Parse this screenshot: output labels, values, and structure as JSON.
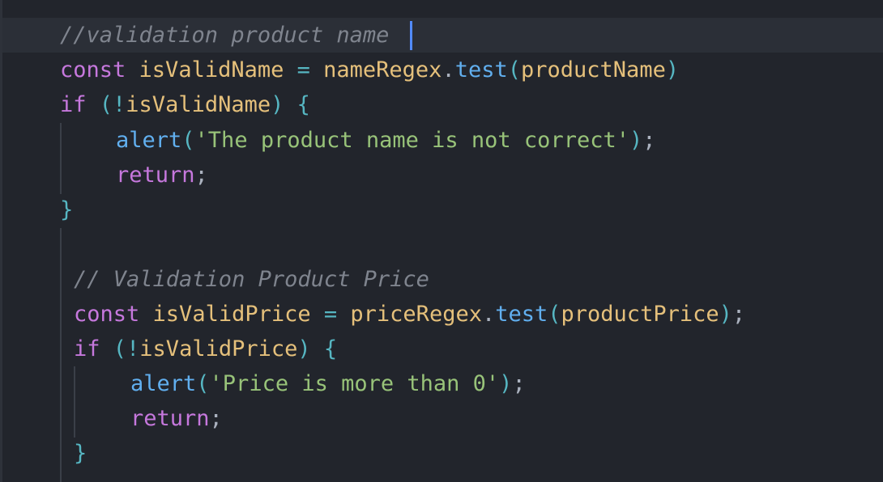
{
  "code": {
    "lines": [
      {
        "tokens": [
          {
            "text": "//validation product name",
            "cls": "cm"
          }
        ]
      },
      {
        "tokens": [
          {
            "text": "const",
            "cls": "kw"
          },
          {
            "text": " ",
            "cls": "plain"
          },
          {
            "text": "isValidName",
            "cls": "var"
          },
          {
            "text": " = ",
            "cls": "punc"
          },
          {
            "text": "nameRegex",
            "cls": "var"
          },
          {
            "text": ".",
            "cls": "plain"
          },
          {
            "text": "test",
            "cls": "fn"
          },
          {
            "text": "(",
            "cls": "punc"
          },
          {
            "text": "productName",
            "cls": "var"
          },
          {
            "text": ")",
            "cls": "punc"
          }
        ]
      },
      {
        "tokens": [
          {
            "text": "if",
            "cls": "kw"
          },
          {
            "text": " ",
            "cls": "plain"
          },
          {
            "text": "(!",
            "cls": "punc"
          },
          {
            "text": "isValidName",
            "cls": "var"
          },
          {
            "text": ")",
            "cls": "punc"
          },
          {
            "text": " ",
            "cls": "plain"
          },
          {
            "text": "{",
            "cls": "punc"
          }
        ]
      },
      {
        "tokens": [
          {
            "text": "alert",
            "cls": "fn"
          },
          {
            "text": "(",
            "cls": "punc"
          },
          {
            "text": "'The product name is not correct'",
            "cls": "str"
          },
          {
            "text": ")",
            "cls": "punc"
          },
          {
            "text": ";",
            "cls": "plain"
          }
        ]
      },
      {
        "tokens": [
          {
            "text": "return",
            "cls": "kw"
          },
          {
            "text": ";",
            "cls": "plain"
          }
        ]
      },
      {
        "tokens": [
          {
            "text": "}",
            "cls": "punc"
          }
        ]
      },
      {
        "tokens": [
          {
            "text": "// Validation Product Price",
            "cls": "cm"
          }
        ]
      },
      {
        "tokens": [
          {
            "text": "const",
            "cls": "kw"
          },
          {
            "text": " ",
            "cls": "plain"
          },
          {
            "text": "isValidPrice",
            "cls": "var"
          },
          {
            "text": " = ",
            "cls": "punc"
          },
          {
            "text": "priceRegex",
            "cls": "var"
          },
          {
            "text": ".",
            "cls": "plain"
          },
          {
            "text": "test",
            "cls": "fn"
          },
          {
            "text": "(",
            "cls": "punc"
          },
          {
            "text": "productPrice",
            "cls": "var"
          },
          {
            "text": ")",
            "cls": "punc"
          },
          {
            "text": ";",
            "cls": "plain"
          }
        ]
      },
      {
        "tokens": [
          {
            "text": "if",
            "cls": "kw"
          },
          {
            "text": " ",
            "cls": "plain"
          },
          {
            "text": "(!",
            "cls": "punc"
          },
          {
            "text": "isValidPrice",
            "cls": "var"
          },
          {
            "text": ")",
            "cls": "punc"
          },
          {
            "text": " ",
            "cls": "plain"
          },
          {
            "text": "{",
            "cls": "punc"
          }
        ]
      },
      {
        "tokens": [
          {
            "text": "alert",
            "cls": "fn"
          },
          {
            "text": "(",
            "cls": "punc"
          },
          {
            "text": "'Price is more than 0'",
            "cls": "str"
          },
          {
            "text": ")",
            "cls": "punc"
          },
          {
            "text": ";",
            "cls": "plain"
          }
        ]
      },
      {
        "tokens": [
          {
            "text": "return",
            "cls": "kw"
          },
          {
            "text": ";",
            "cls": "plain"
          }
        ]
      },
      {
        "tokens": [
          {
            "text": "}",
            "cls": "punc"
          }
        ]
      }
    ]
  }
}
